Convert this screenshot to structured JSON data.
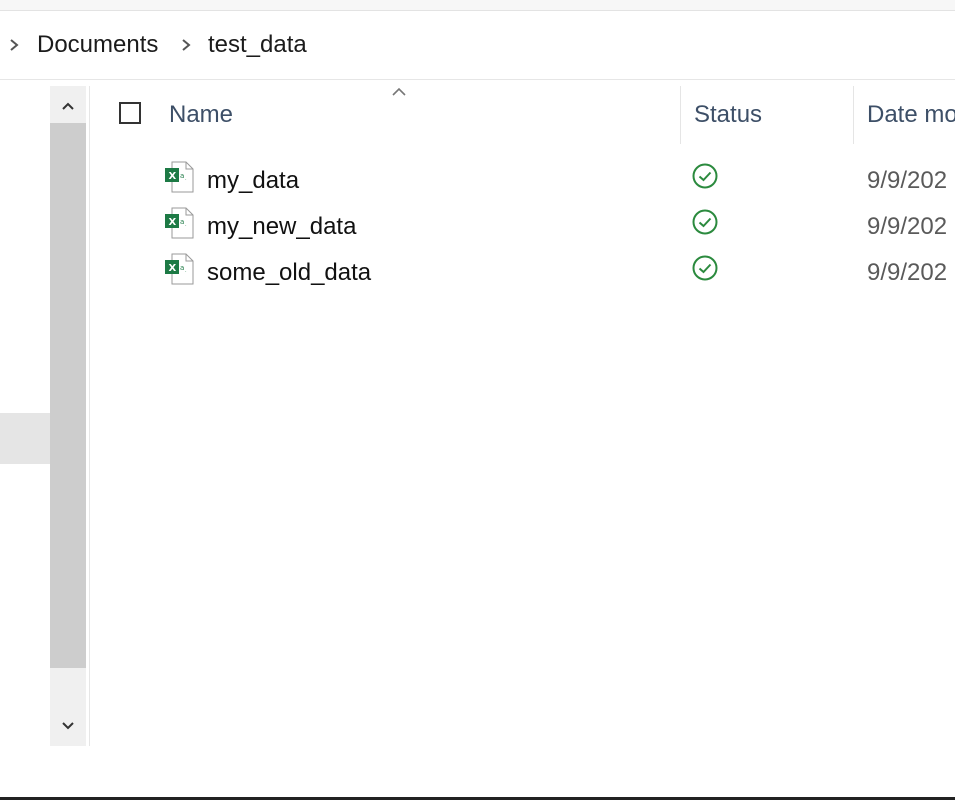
{
  "breadcrumb": {
    "items": [
      "Documents",
      "test_data"
    ]
  },
  "columns": {
    "name": "Name",
    "status": "Status",
    "date": "Date mo"
  },
  "files": [
    {
      "name": "my_data",
      "status": "available",
      "date": "9/9/202"
    },
    {
      "name": "my_new_data",
      "status": "available",
      "date": "9/9/202"
    },
    {
      "name": "some_old_data",
      "status": "available",
      "date": "9/9/202"
    }
  ],
  "icons": {
    "file": "excel-file-icon",
    "status": "check-circle-icon",
    "crumb_separator": "chevron-right-icon",
    "sort": "chevron-up-icon",
    "scroll_up": "chevron-up-icon",
    "scroll_down": "chevron-down-icon"
  },
  "colors": {
    "excel_green": "#1d7a45",
    "status_green": "#2b8a3e",
    "header_text": "#3d4f67",
    "scroll_thumb": "#cdcdcd"
  }
}
